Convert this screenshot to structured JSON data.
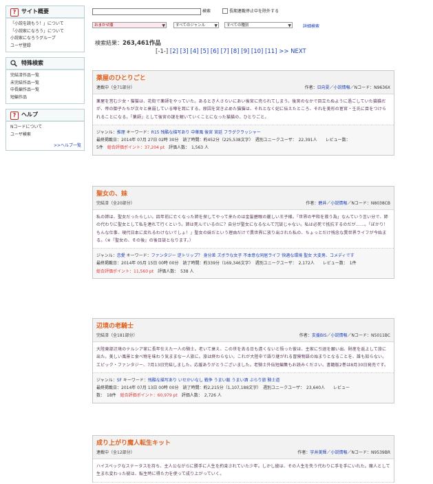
{
  "sidebar": {
    "overview": {
      "title": "サイト概要",
      "items": [
        "「小説を読もう！」について",
        "「小説家になろう」について",
        "小説家になろうグループ",
        "ユーザ登録"
      ]
    },
    "special": {
      "title": "特殊検索",
      "items": [
        "完結済作品一覧",
        "未完結作品一覧",
        "中長編作品一覧",
        "短編作品"
      ]
    },
    "help": {
      "title": "ヘルプ",
      "items": [
        "Nコードについて",
        "ユーザ検索"
      ],
      "more": ">>ヘルプ一覧"
    }
  },
  "search": {
    "input_value": "",
    "button_label": "検索",
    "exclude_label": "長期連載停止中を除外する",
    "order_selected": "おまかせ順",
    "genre_selected": "すべてのジャンル",
    "type_selected": "すべての種別",
    "advanced_label": "詳細検索",
    "result_label": "検索結果：",
    "result_count": "263,461作品"
  },
  "pager": {
    "current": "[-1-]",
    "pages": [
      "[2]",
      "[3]",
      "[4]",
      "[5]",
      "[6]",
      "[7]",
      "[8]",
      "[9]",
      "[10]",
      "[11]"
    ],
    "next": ">> NEXT"
  },
  "novels": [
    {
      "title": "薬屋のひとりごと",
      "status": "連載中（全71部分）",
      "author_prefix": "作者：",
      "author": "日向夏",
      "author_suffix": "／",
      "info_link": "小説情報",
      "ncode": "／Nコード：N9636X",
      "synopsis": "薬屋を営む少女・猫猫は、花街で薬師をやっていた。あるとき人さらいにあい後宮に売られてしまう。後宮のなかで目立たぬように過ごしていた猫猫だが、帝の御子たちが次々と衰弱している噂を耳にする。原因を突き止めた猫猫は、それとなく妃に伝えたところ、それを美形の宦官・壬氏に目をつけられることになる。「薬師」として後宮の謎を解いていくことになった猫猫の、ひとりごと。",
      "genre_label": "ジャンル：",
      "genre": "推理",
      "keyword_label": "キーワード：",
      "keywords": "R15 残酷な描写あり 中華風 後宮 宮廷 フラグクラッシャー",
      "line1": "最終掲載日：2014年 07月 27日 02時 30分　読了時間：約452分（225,538文字）　週別ユニークユーザ：　22,391人　　レビュー数：",
      "reviews": "5件",
      "points_label": "総合評価ポイント：",
      "points": "37,204 pt",
      "evaluators": "評価人数：　1,563 人"
    },
    {
      "title": "聖女の、妹",
      "status": "完結済（全20部分）",
      "author_prefix": "作者：",
      "author": "碧井",
      "author_suffix": "／",
      "info_link": "小説情報",
      "ncode": "／Nコード：N8038CB",
      "synopsis": "私の姉は、聖女だったらしい。四年前に亡くなった姉を探してやって来たのは金髪碧眼の麗しい王子様。「世界の平和を救う為」なんていう言い分で、姉の代わりに聖女として私を連れて行くという。姉は死んでいるのに？自分が聖女になるなんて冗談じゃない。私は必死で抵抗するのだが……。「ぼかり！もんな仕事、現代日本に戻れるわけないでしょ！」聖女の妹だという理由だけで異世界に放り出された私の、ちょっとだけ残念な異世界ライフが今始まる。（※『聖女の、その後』の後日談となります。）",
      "genre_label": "ジャンル：",
      "genre": "恋愛",
      "keyword_label": "キーワード：",
      "keywords": "ファンタジー 逆トリップ？ 身分差 ズボラな女子 不本意な同居ライフ 快適な環境 聖女 大変男、コメディです",
      "line1": "最終掲載日：2014年 05月 15日 00時 00分　読了時間：約339分（169,346文字）　週別ユニークユーザ：　2,172人　　レビュー数：　1件",
      "reviews": "",
      "points_label": "総合評価ポイント：",
      "points": "11,560 pt",
      "evaluators": "評価人数：　538 人"
    },
    {
      "title": "辺境の老騎士",
      "status": "完結済（全181部分）",
      "author_prefix": "作者：",
      "author": "支援BIS",
      "author_suffix": "／",
      "info_link": "小説情報",
      "ncode": "／Nコード：N5011BC",
      "synopsis": "大陸東部辺境のテルシア家に長年仕えた一人の騎士。老いて衰え、この世を去る日も遠くないと悟った彼は、主家に引退を願い出、財産を返上して旅に出た。美しい風景と食べ物を味わう気ままな一人旅に。旅は終わらない。これが大陸中で語り継がれる冒険物語の始まりとなることを、誰も知らない。エピック・ファンタジー、7月13日完結しました。応援ありがとうございました。老騎士外伝短編集もお読みください。書籍版2巻は8月30日発売です。",
      "genre_label": "ジャンル：",
      "genre": "SF",
      "keyword_label": "キーワード：",
      "keywords": "残酷な描写あり いせかいなし 戦争 うまい飯 うまい酒 ぶらり旅 騎士道",
      "line1": "最終掲載日：2014年 07月 13日 00時 00分　読了時間：約2,215分（1,107,188文字）　週別ユニークユーザ：　23,640人　　レビュー",
      "reviews": "数：　18件",
      "points_label": "総合評価ポイント：",
      "points": "60,979 pt",
      "evaluators": "評価人数：　2,726 人"
    },
    {
      "title": "成り上がり魔人転生キット",
      "status": "連載中（全12部分）",
      "author_prefix": "作者：",
      "author": "宇井美輝",
      "author_suffix": "／",
      "info_link": "小説情報",
      "ncode": "／Nコード：N9539BR",
      "synopsis": "ハイスペックなステータスを持ち、主人公ながらに勝手に人生を約束されていた少年。しかし彼は、その人生を失う代わりに手を手にいれた。魔人として生まれ変わった彼は、転生時に得た力を使って成り上がっていく。",
      "genre_label": "",
      "genre": "",
      "keyword_label": "",
      "keywords": "",
      "line1": "",
      "reviews": "",
      "points_label": "",
      "points": "",
      "evaluators": ""
    }
  ]
}
